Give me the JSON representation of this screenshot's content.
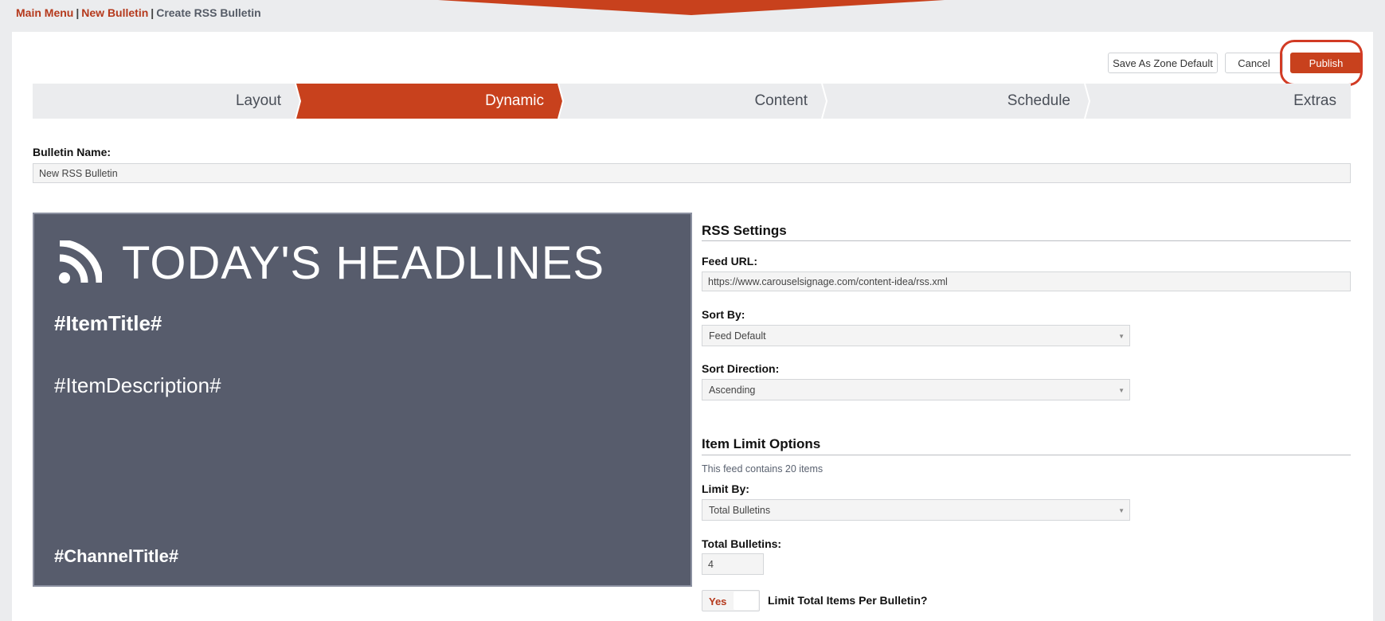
{
  "breadcrumb": {
    "main_menu": "Main Menu",
    "new_bulletin": "New Bulletin",
    "separator": "|",
    "current": "Create RSS Bulletin"
  },
  "actions": {
    "save_zone_default": "Save As Zone Default",
    "cancel": "Cancel",
    "publish": "Publish"
  },
  "steps": [
    {
      "label": "Layout",
      "active": false
    },
    {
      "label": "Dynamic",
      "active": true
    },
    {
      "label": "Content",
      "active": false
    },
    {
      "label": "Schedule",
      "active": false
    },
    {
      "label": "Extras",
      "active": false
    }
  ],
  "bulletin_name": {
    "label": "Bulletin Name:",
    "value": "New RSS Bulletin"
  },
  "preview": {
    "icon": "rss-icon",
    "headline": "TODAY'S HEADLINES",
    "item_title": "#ItemTitle#",
    "item_description": "#ItemDescription#",
    "channel_title": "#ChannelTitle#"
  },
  "rss_settings": {
    "title": "RSS Settings",
    "feed_url_label": "Feed URL:",
    "feed_url_value": "https://www.carouselsignage.com/content-idea/rss.xml",
    "sort_by_label": "Sort By:",
    "sort_by_value": "Feed Default",
    "sort_direction_label": "Sort Direction:",
    "sort_direction_value": "Ascending"
  },
  "item_limit": {
    "title": "Item Limit Options",
    "hint": "This feed contains 20 items",
    "limit_by_label": "Limit By:",
    "limit_by_value": "Total Bulletins",
    "total_bulletins_label": "Total Bulletins:",
    "total_bulletins_value": "4",
    "toggle_label": "Yes",
    "toggle_on": true,
    "limit_items_label": "Limit Total Items Per Bulletin?"
  },
  "colors": {
    "accent": "#c8411d",
    "link": "#b5391c",
    "preview_bg": "#575c6c",
    "page_bg": "#ebecee"
  }
}
